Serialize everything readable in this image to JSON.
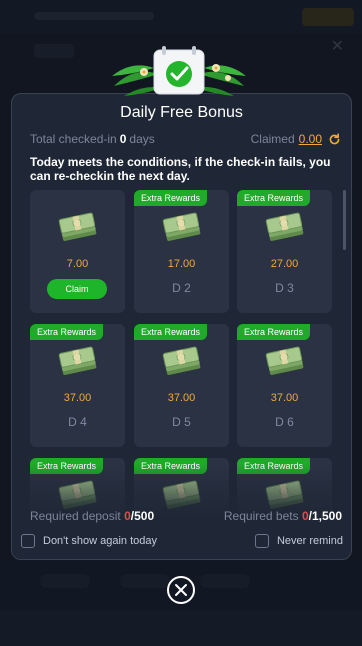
{
  "modal": {
    "title": "Daily Free Bonus",
    "total_checked_label": "Total checked-in",
    "total_checked_value": "0",
    "total_checked_unit": "days",
    "claimed_label": "Claimed",
    "claimed_value": "0.00",
    "notice": "Today meets the conditions, if the check-in fails, you can re-checkin the next day."
  },
  "cards": [
    {
      "amount": "7.00",
      "day": "",
      "badge": "",
      "claim_label": "Claim"
    },
    {
      "amount": "17.00",
      "day": "D 2",
      "badge": "Extra Rewards"
    },
    {
      "amount": "27.00",
      "day": "D 3",
      "badge": "Extra Rewards"
    },
    {
      "amount": "37.00",
      "day": "D 4",
      "badge": "Extra Rewards"
    },
    {
      "amount": "37.00",
      "day": "D 5",
      "badge": "Extra Rewards"
    },
    {
      "amount": "37.00",
      "day": "D 6",
      "badge": "Extra Rewards"
    },
    {
      "amount": "",
      "day": "",
      "badge": "Extra Rewards"
    },
    {
      "amount": "",
      "day": "",
      "badge": "Extra Rewards"
    },
    {
      "amount": "",
      "day": "",
      "badge": "Extra Rewards"
    }
  ],
  "requirements": {
    "deposit_label": "Required deposit",
    "deposit_current": "0",
    "deposit_total": "/500",
    "bets_label": "Required bets",
    "bets_current": "0",
    "bets_total": "/1,500"
  },
  "options": {
    "dont_show_today": "Don't show again today",
    "never_remind": "Never remind"
  },
  "icons": {
    "check": "check-circle-icon",
    "refresh": "refresh-icon",
    "money": "cash-stack-icon",
    "close": "close-circle-icon"
  },
  "colors": {
    "accent_green": "#1fb52b",
    "amount_orange": "#f2a93b",
    "deficit_red": "#e24b4b"
  }
}
